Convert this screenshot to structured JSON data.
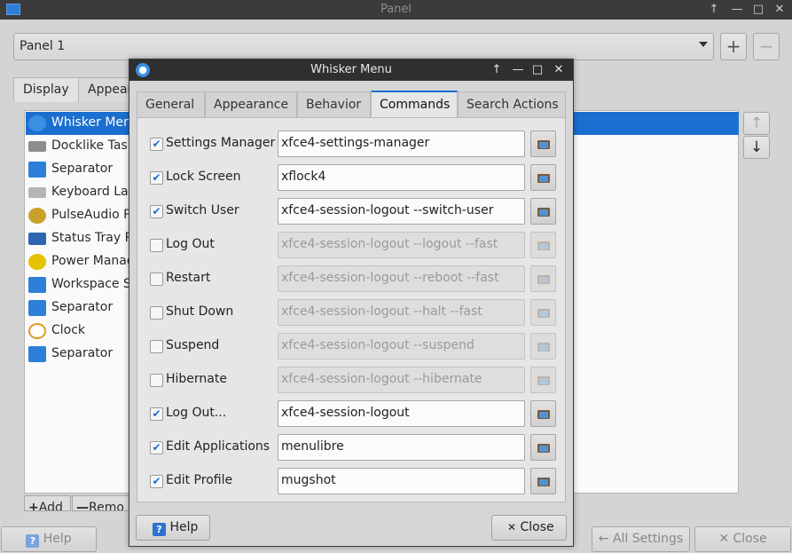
{
  "panel_window": {
    "title": "Panel",
    "panel_select": "Panel 1",
    "tabs": [
      "Display",
      "Appear"
    ],
    "items": [
      {
        "label": "Whisker Menu",
        "icon": "whisker-icon",
        "selected": true
      },
      {
        "label": "Docklike Task",
        "icon": "docklike-icon"
      },
      {
        "label": "Separator",
        "icon": "separator-icon"
      },
      {
        "label": "Keyboard Lay",
        "icon": "keyboard-icon"
      },
      {
        "label": "PulseAudio P",
        "icon": "pulseaudio-icon"
      },
      {
        "label": "Status Tray Pl",
        "icon": "status-tray-icon"
      },
      {
        "label": "Power Manag",
        "icon": "power-icon"
      },
      {
        "label": "Workspace Sw",
        "icon": "workspace-icon"
      },
      {
        "label": "Separator",
        "icon": "separator-icon"
      },
      {
        "label": "Clock",
        "icon": "clock-icon"
      },
      {
        "label": "Separator",
        "icon": "separator-icon"
      }
    ],
    "add_label": "Add",
    "remove_label": "Remo",
    "help_label": "Help",
    "all_settings_label": "All Settings",
    "close_label": "Close"
  },
  "whisker_dialog": {
    "title": "Whisker Menu",
    "tabs": [
      "General",
      "Appearance",
      "Behavior",
      "Commands",
      "Search Actions"
    ],
    "active_tab": "Commands",
    "commands": [
      {
        "label": "Settings Manager",
        "checked": true,
        "command": "xfce4-settings-manager"
      },
      {
        "label": "Lock Screen",
        "checked": true,
        "command": "xflock4"
      },
      {
        "label": "Switch User",
        "checked": true,
        "command": "xfce4-session-logout --switch-user"
      },
      {
        "label": "Log Out",
        "checked": false,
        "command": "xfce4-session-logout --logout --fast"
      },
      {
        "label": "Restart",
        "checked": false,
        "command": "xfce4-session-logout --reboot --fast"
      },
      {
        "label": "Shut Down",
        "checked": false,
        "command": "xfce4-session-logout --halt --fast"
      },
      {
        "label": "Suspend",
        "checked": false,
        "command": "xfce4-session-logout --suspend"
      },
      {
        "label": "Hibernate",
        "checked": false,
        "command": "xfce4-session-logout --hibernate"
      },
      {
        "label": "Log Out...",
        "checked": true,
        "command": "xfce4-session-logout"
      },
      {
        "label": "Edit Applications",
        "checked": true,
        "command": "menulibre"
      },
      {
        "label": "Edit Profile",
        "checked": true,
        "command": "mugshot"
      }
    ],
    "help_label": "Help",
    "close_label": "Close"
  }
}
